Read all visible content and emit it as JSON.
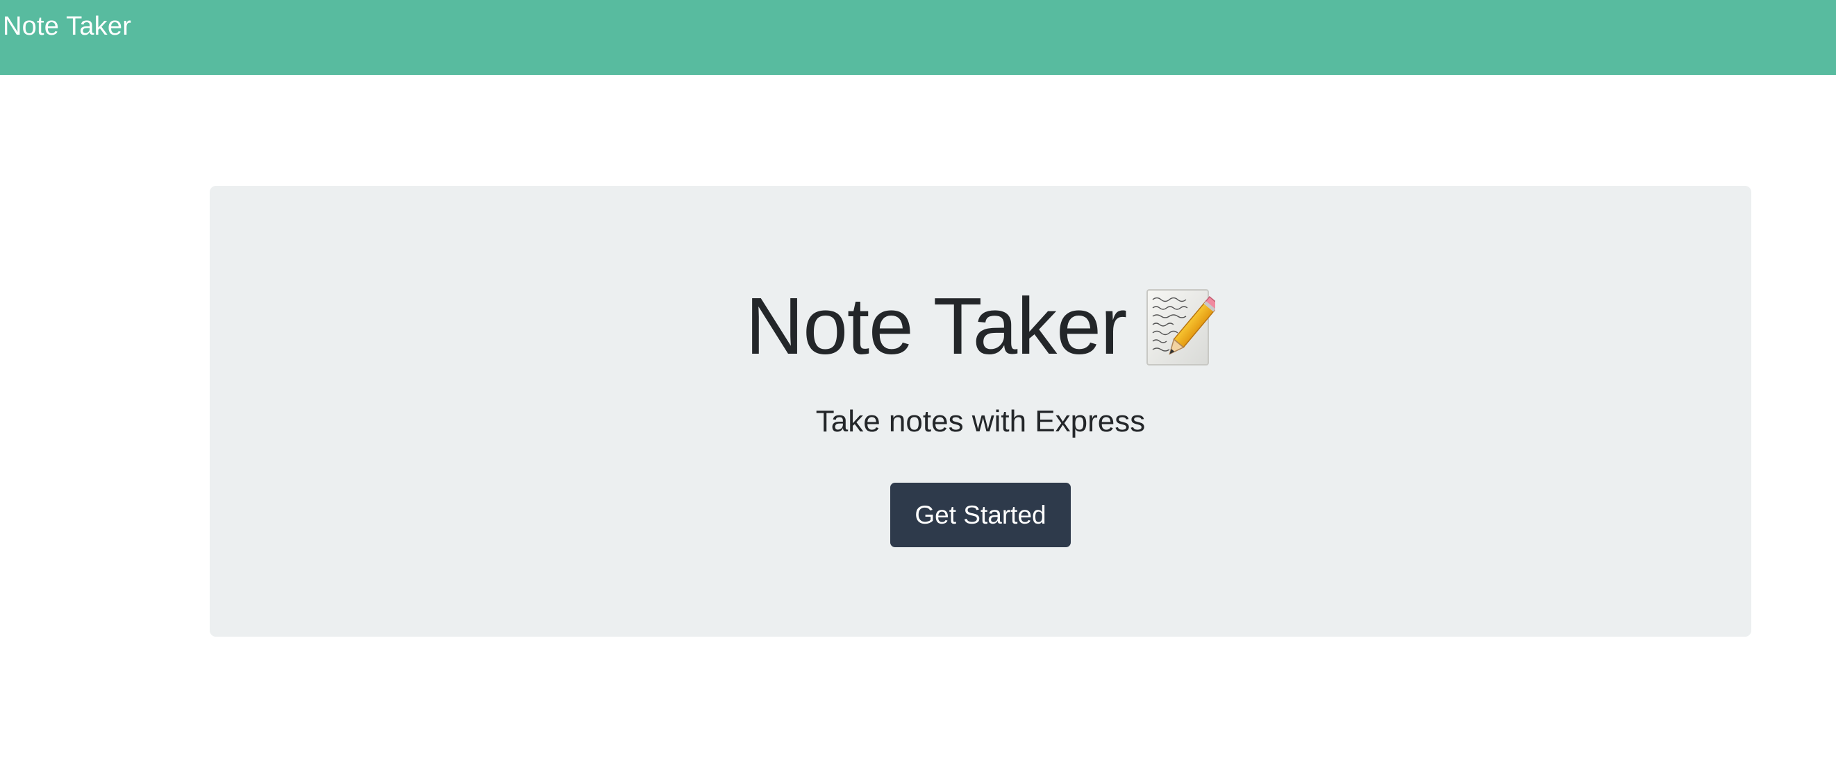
{
  "navbar": {
    "brand": "Note Taker",
    "background_color": "#58bb9f"
  },
  "hero": {
    "title": "Note Taker",
    "title_icon": "memo-icon",
    "subtitle": "Take notes with Express",
    "button_label": "Get Started",
    "panel_color": "#eceff0",
    "button_color": "#2e3a4b"
  }
}
